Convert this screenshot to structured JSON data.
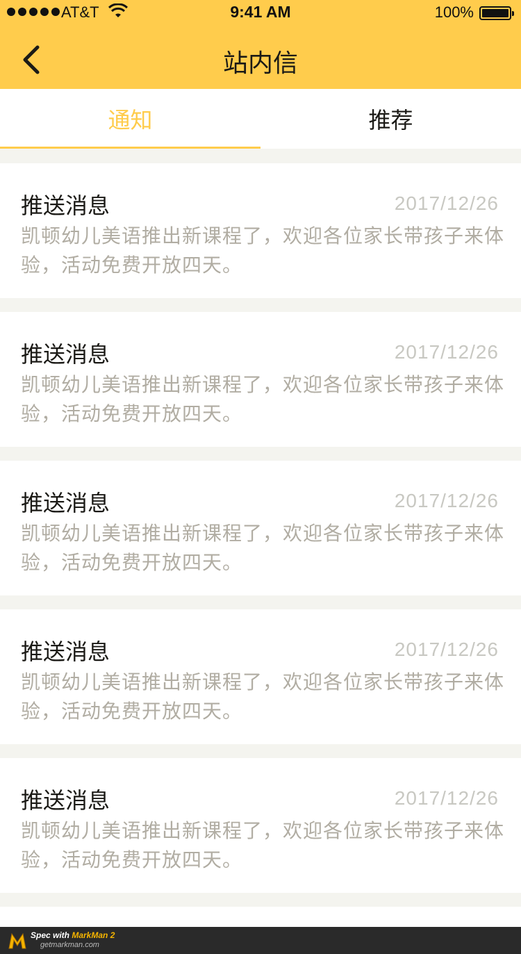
{
  "status_bar": {
    "carrier": "AT&T",
    "time": "9:41 AM",
    "battery": "100%"
  },
  "nav": {
    "back_icon": "chevron-left-icon",
    "title": "站内信"
  },
  "tabs": [
    {
      "label": "通知",
      "active": true
    },
    {
      "label": "推荐",
      "active": false
    }
  ],
  "colors": {
    "accent": "#ffcc4c",
    "text_primary": "#1b1a16",
    "text_secondary": "#b1ada3",
    "background": "#f4f4ef"
  },
  "messages": [
    {
      "title": "推送消息",
      "date": "2017/12/26",
      "body": "凯顿幼儿美语推出新课程了，欢迎各位家长带孩子来体验，活动免费开放四天。"
    },
    {
      "title": "推送消息",
      "date": "2017/12/26",
      "body": "凯顿幼儿美语推出新课程了，欢迎各位家长带孩子来体验，活动免费开放四天。"
    },
    {
      "title": "推送消息",
      "date": "2017/12/26",
      "body": "凯顿幼儿美语推出新课程了，欢迎各位家长带孩子来体验，活动免费开放四天。"
    },
    {
      "title": "推送消息",
      "date": "2017/12/26",
      "body": "凯顿幼儿美语推出新课程了，欢迎各位家长带孩子来体验，活动免费开放四天。"
    },
    {
      "title": "推送消息",
      "date": "2017/12/26",
      "body": "凯顿幼儿美语推出新课程了，欢迎各位家长带孩子来体验，活动免费开放四天。"
    }
  ],
  "spec_footer": {
    "prefix": "Spec with ",
    "brand": "MarkMan 2",
    "url": "getmarkman.com"
  }
}
